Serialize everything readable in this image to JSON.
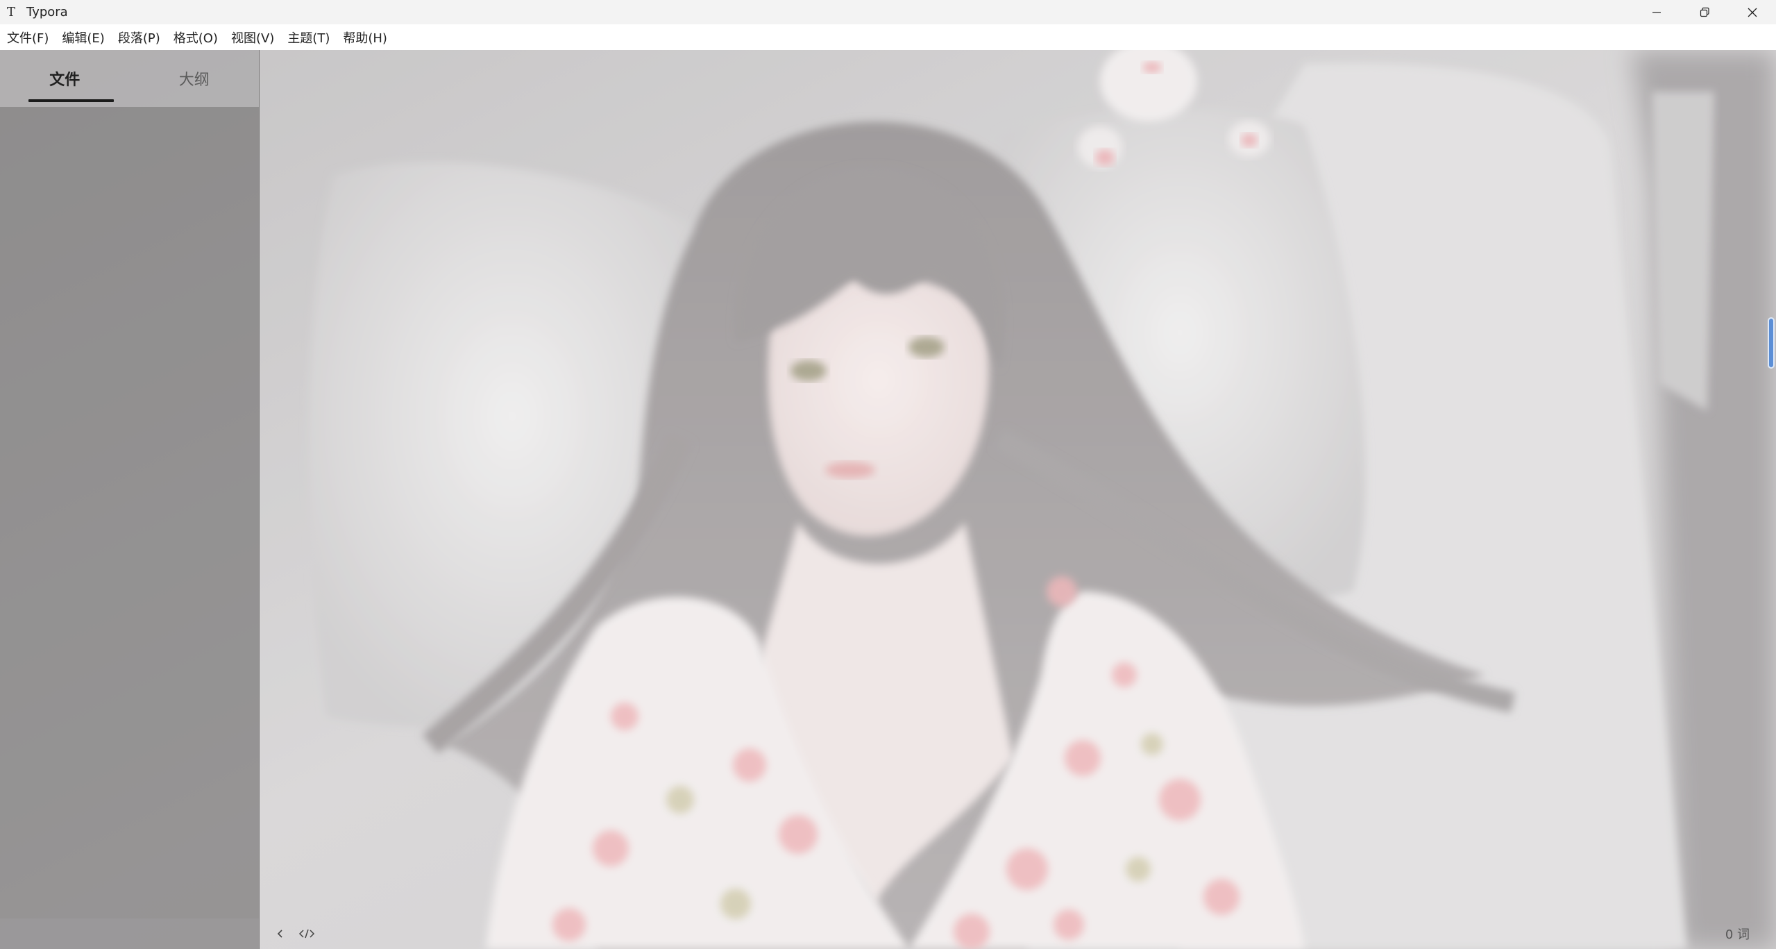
{
  "app": {
    "title": "Typora",
    "icon_glyph": "T",
    "icon_name": "typora-app-icon"
  },
  "window_controls": {
    "minimize": "minimize-icon",
    "restore": "restore-icon",
    "close": "close-icon"
  },
  "menu": {
    "items": [
      {
        "label": "文件(F)"
      },
      {
        "label": "编辑(E)"
      },
      {
        "label": "段落(P)"
      },
      {
        "label": "格式(O)"
      },
      {
        "label": "视图(V)"
      },
      {
        "label": "主题(T)"
      },
      {
        "label": "帮助(H)"
      }
    ]
  },
  "sidebar": {
    "tabs": [
      {
        "label": "文件",
        "active": true
      },
      {
        "label": "大纲",
        "active": false
      }
    ]
  },
  "editor": {
    "footer": {
      "back_icon": "chevron-left-icon",
      "source_icon": "source-code-icon",
      "word_count": "0 词"
    }
  },
  "colors": {
    "scrollbar_accent": "#5b8ed6",
    "active_tab_indicator": "#1b1b1b"
  }
}
